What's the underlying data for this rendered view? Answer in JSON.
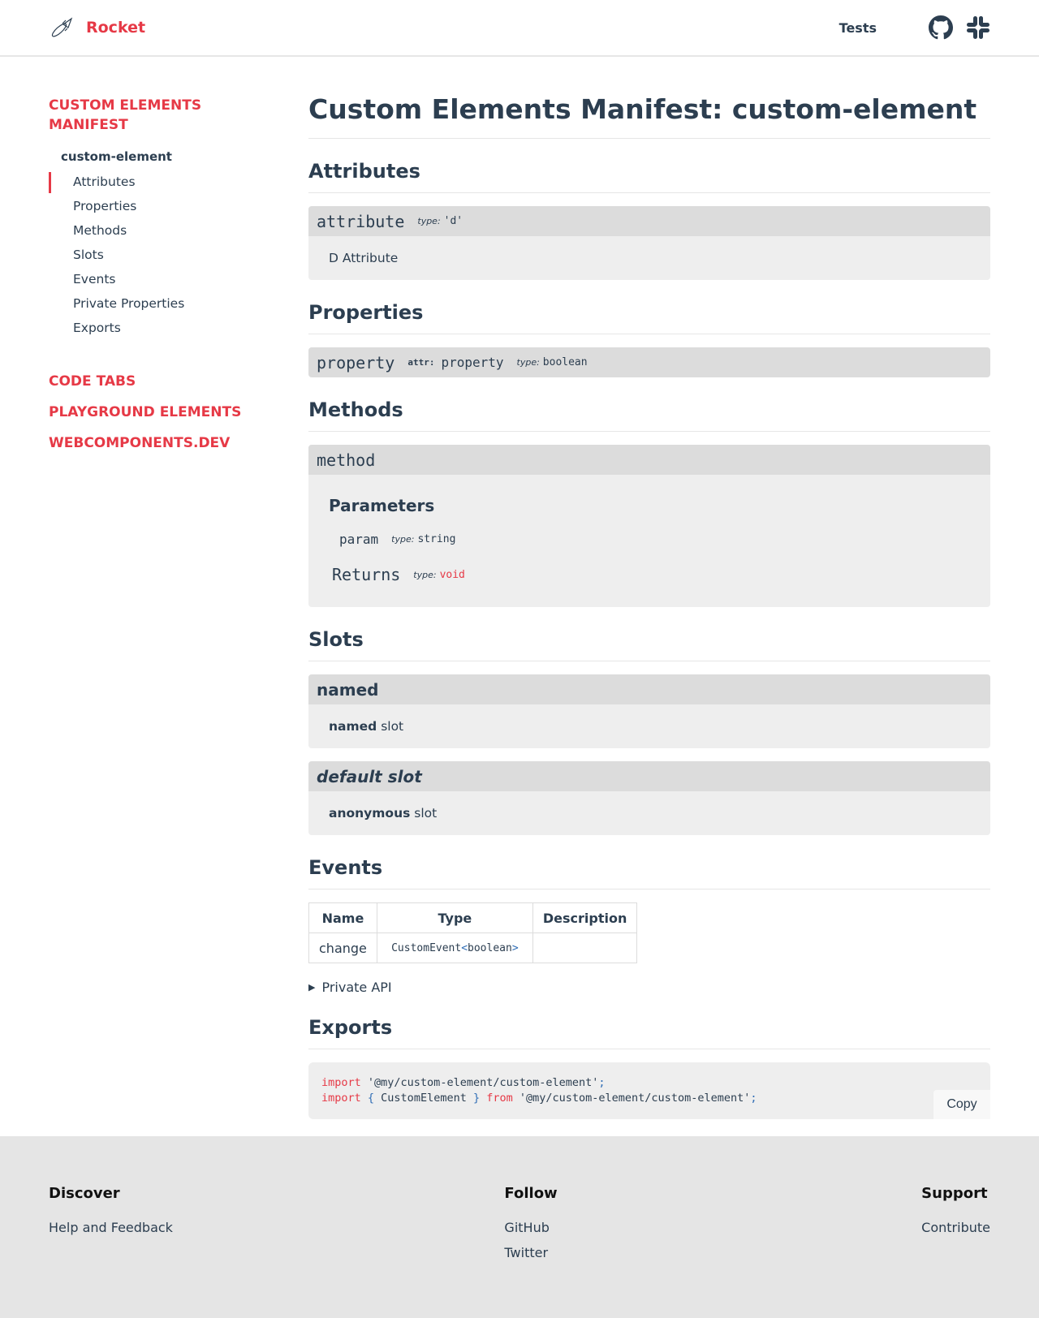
{
  "header": {
    "logo_icon": "rocket-icon",
    "brand": "Rocket",
    "nav_tests": "Tests",
    "icons": [
      "github-icon",
      "slack-icon"
    ]
  },
  "sidebar": {
    "group_main": "CUSTOM ELEMENTS MANIFEST",
    "subheading": "custom-element",
    "items": [
      {
        "label": "Attributes",
        "active": true
      },
      {
        "label": "Properties"
      },
      {
        "label": "Methods"
      },
      {
        "label": "Slots"
      },
      {
        "label": "Events"
      },
      {
        "label": "Private Properties"
      },
      {
        "label": "Exports"
      }
    ],
    "groups": [
      "CODE TABS",
      "PLAYGROUND ELEMENTS",
      "WEBCOMPONENTS.DEV"
    ]
  },
  "main": {
    "title": "Custom Elements Manifest: custom-element",
    "attributes": {
      "heading": "Attributes",
      "name": "attribute",
      "type_label": "type:",
      "type_value": "'d'",
      "description": "D Attribute"
    },
    "properties": {
      "heading": "Properties",
      "name": "property",
      "attr_label": "attr:",
      "attr_value": "property",
      "type_label": "type:",
      "type_value": "boolean"
    },
    "methods": {
      "heading": "Methods",
      "name": "method",
      "params_heading": "Parameters",
      "param_name": "param",
      "param_type_label": "type:",
      "param_type": "string",
      "returns_label": "Returns",
      "returns_type_label": "type:",
      "returns_type": "void"
    },
    "slots": {
      "heading": "Slots",
      "items": [
        {
          "name": "named",
          "desc_bold": "named",
          "desc_rest": " slot"
        },
        {
          "name": "default slot",
          "desc_bold": "anonymous",
          "desc_rest": " slot"
        }
      ]
    },
    "events": {
      "heading": "Events",
      "columns": [
        "Name",
        "Type",
        "Description"
      ],
      "rows": [
        {
          "name": "change",
          "type_base": "CustomEvent",
          "type_lt": "<",
          "type_param": "boolean",
          "type_gt": ">",
          "description": ""
        }
      ]
    },
    "private_api": "Private API",
    "exports": {
      "heading": "Exports",
      "line1": {
        "kw": "import",
        "str": " '@my/custom-element/custom-element'",
        "semi": ";"
      },
      "line2": {
        "kw": "import",
        "lb": " {",
        "name": " CustomElement ",
        "rb": "}",
        "from": " from",
        "str": " '@my/custom-element/custom-element'",
        "semi": ";"
      },
      "copy_label": "Copy"
    }
  },
  "footer": {
    "columns": [
      {
        "heading": "Discover",
        "links": [
          "Help and Feedback"
        ]
      },
      {
        "heading": "Follow",
        "links": [
          "GitHub",
          "Twitter"
        ]
      },
      {
        "heading": "Support",
        "links": [
          "Contribute"
        ]
      }
    ]
  },
  "colors": {
    "accent": "#e63946",
    "text": "#2c3e50",
    "card": "#eeeeee",
    "card_head": "#dcdcdc",
    "footer_bg": "#e5e5e5"
  }
}
